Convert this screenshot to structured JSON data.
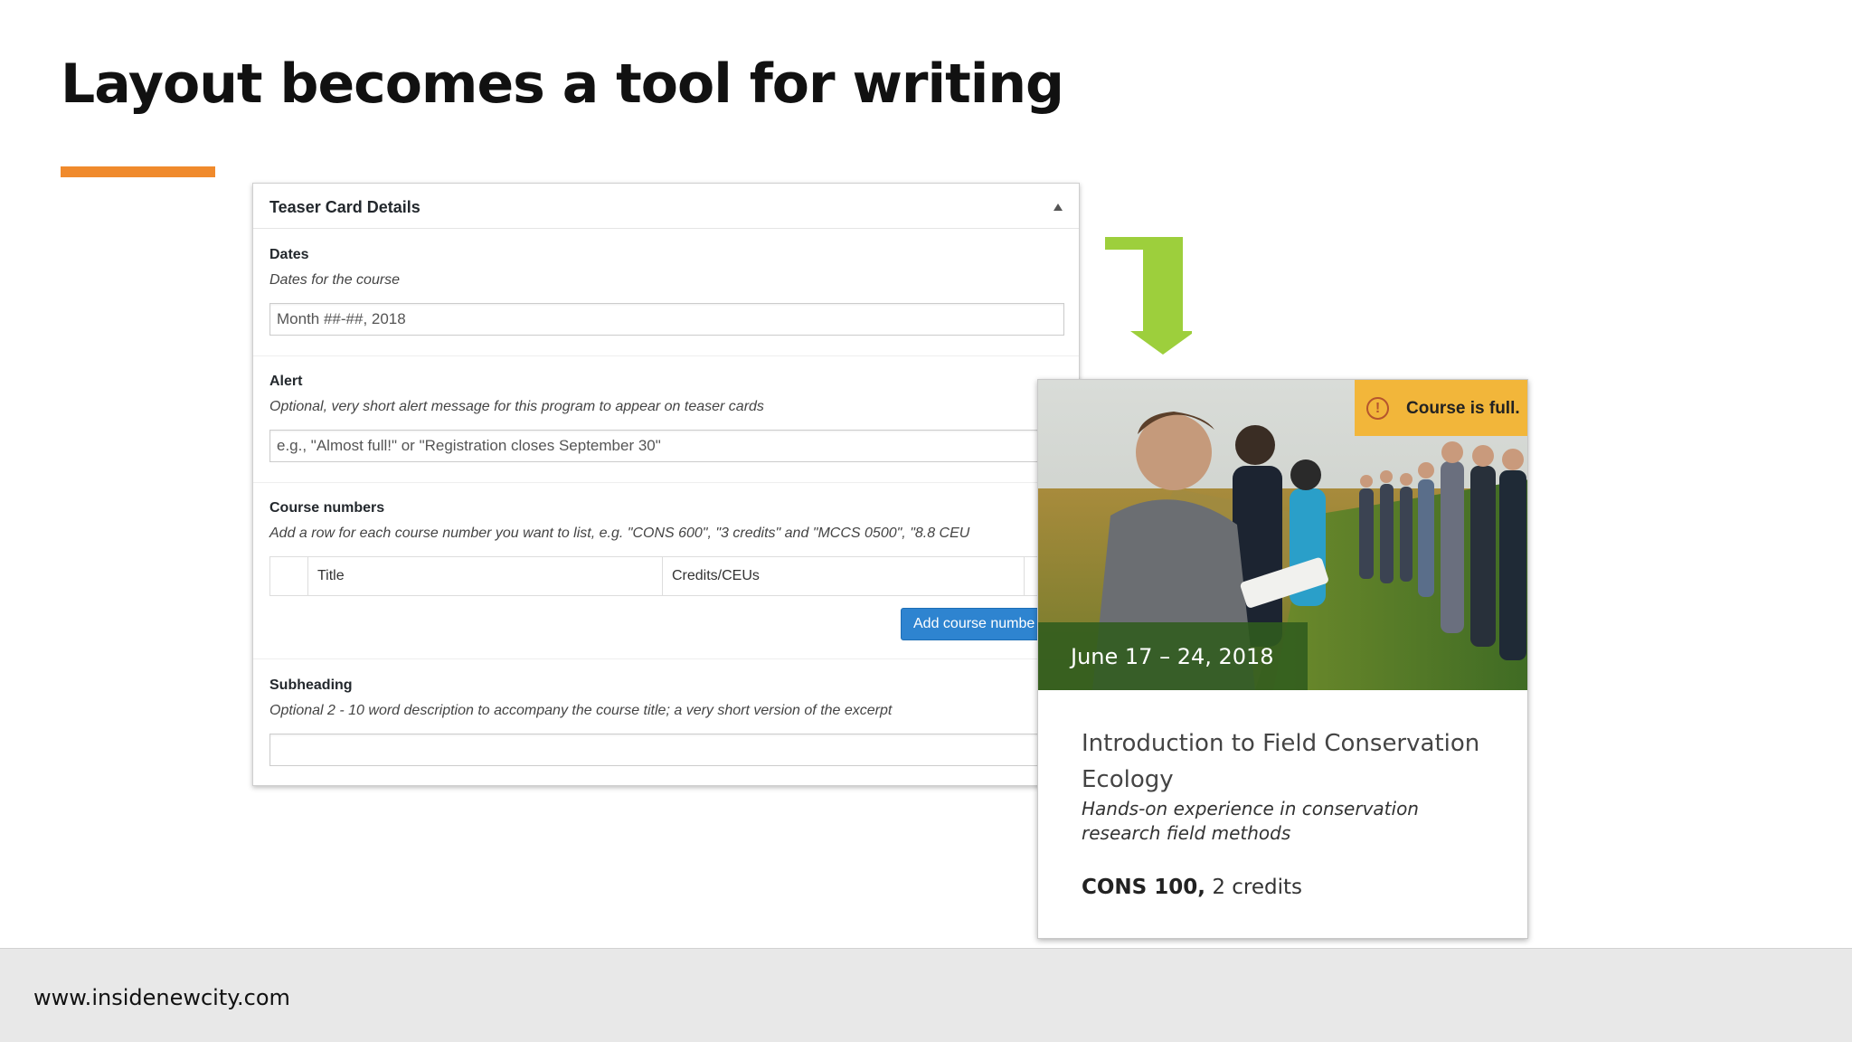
{
  "slide": {
    "title": "Layout becomes a tool for writing",
    "accent_color": "#f08a2c",
    "footer_url": "www.insidenewcity.com"
  },
  "panel": {
    "title": "Teaser Card Details",
    "fields": {
      "dates": {
        "label": "Dates",
        "description": "Dates for the course",
        "value": "Month ##-##, 2018"
      },
      "alert": {
        "label": "Alert",
        "description": "Optional, very short alert message for this program to appear on teaser cards",
        "placeholder": "e.g., \"Almost full!\" or \"Registration closes September 30\""
      },
      "course_numbers": {
        "label": "Course numbers",
        "description": "Add a row for each course number you want to list, e.g. \"CONS 600\", \"3 credits\" and \"MCCS 0500\", \"8.8 CEU",
        "columns": [
          "Title",
          "Credits/CEUs"
        ],
        "add_button_label": "Add course numbe"
      },
      "subheading": {
        "label": "Subheading",
        "description": "Optional 2 - 10 word description to accompany the course title; a very short version of the excerpt",
        "value": ""
      }
    }
  },
  "arrow": {
    "color": "#9dcf3c",
    "icon": "bent-arrow-down-icon"
  },
  "card": {
    "alert_text": "Course is full.",
    "alert_color": "#f2b63a",
    "date": "June 17 – 24, 2018",
    "title": "Introduction to Field Conservation Ecology",
    "subtitle": "Hands-on experience in conservation research field methods",
    "course_number": "CONS 100,",
    "credits": "2 credits"
  }
}
